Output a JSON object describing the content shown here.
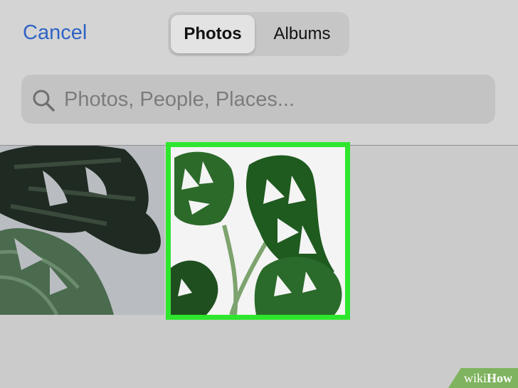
{
  "header": {
    "cancel_label": "Cancel",
    "tabs": [
      {
        "label": "Photos",
        "active": true
      },
      {
        "label": "Albums",
        "active": false
      }
    ]
  },
  "search": {
    "placeholder": "Photos, People, Places..."
  },
  "photos": [
    {
      "subject": "monstera leaves on grey",
      "selected": false
    },
    {
      "subject": "monstera leaves on white",
      "selected": true
    }
  ],
  "colors": {
    "accent": "#2f63c4",
    "selection": "#2ee62e",
    "background": "#cbcbcb"
  },
  "watermark": {
    "prefix": "wiki",
    "brand": "How"
  }
}
